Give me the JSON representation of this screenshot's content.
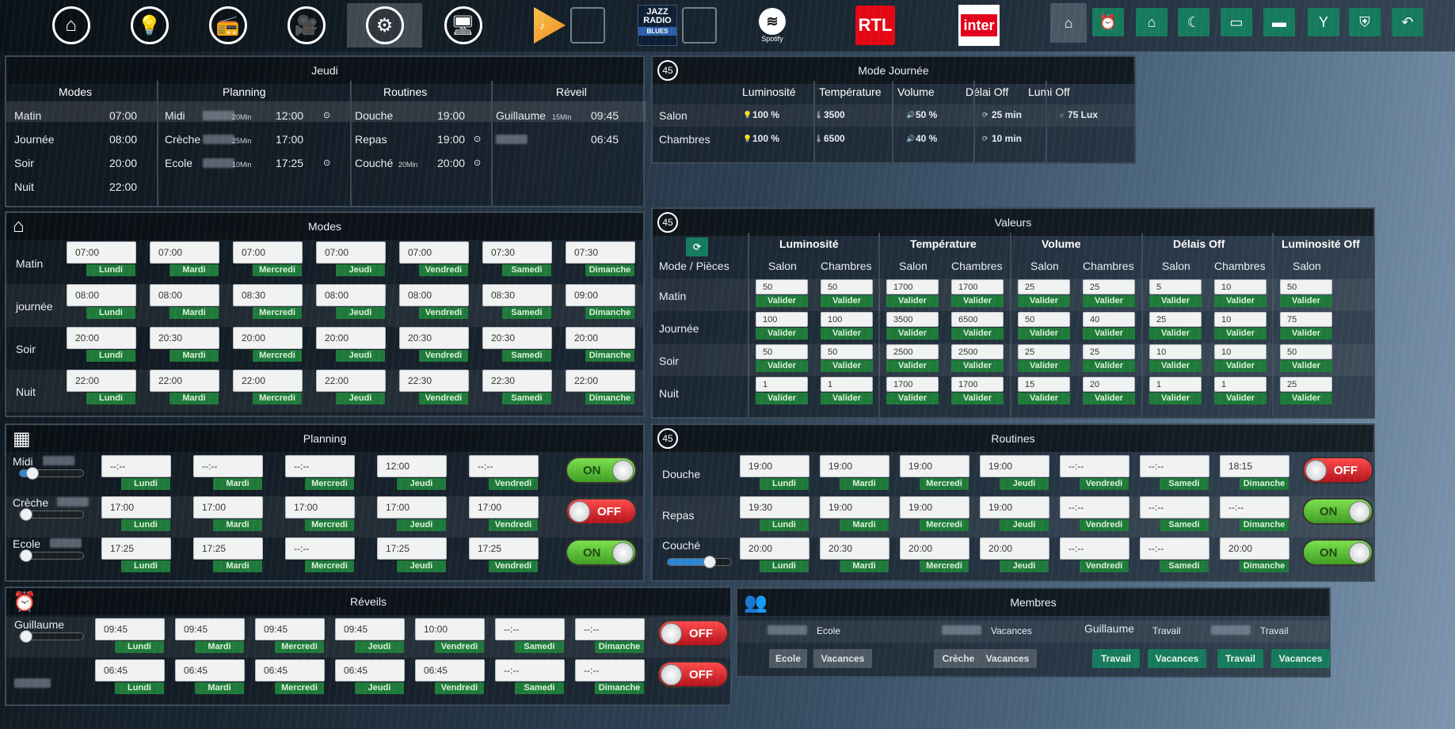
{
  "nav": {
    "items": [
      "home-icon",
      "bulb-icon",
      "radio-icon",
      "camera-icon",
      "gear-icon",
      "monitor-icon"
    ],
    "active": 4
  },
  "media": {
    "jazz": [
      "JAZZ",
      "RADIO"
    ],
    "jazz_sub": "BLUES",
    "spotify": "Spotify",
    "rtl": "RTL",
    "inter": "inter"
  },
  "quick": [
    "home-icon",
    "alarm-icon",
    "house-icon",
    "moon-icon",
    "tv-icon",
    "sofa-icon",
    "cocktail-icon",
    "shield-icon",
    "back-icon"
  ],
  "jeudi": {
    "title": "Jeudi",
    "headers": [
      "Modes",
      "Planning",
      "Routines",
      "Réveil"
    ],
    "modes": [
      [
        "Matin",
        "07:00"
      ],
      [
        "Journée",
        "08:00"
      ],
      [
        "Soir",
        "20:00"
      ],
      [
        "Nuit",
        "22:00"
      ]
    ],
    "planning": [
      [
        "Midi",
        "20Min",
        "12:00"
      ],
      [
        "Crèche",
        "25Min",
        "17:00"
      ],
      [
        "Ecole",
        "10Min",
        "17:25"
      ]
    ],
    "routines": [
      [
        "Douche",
        "",
        "19:00"
      ],
      [
        "Repas",
        "",
        "19:00"
      ],
      [
        "Couché",
        "20Min",
        "20:00"
      ]
    ],
    "reveil": [
      [
        "Guillaume",
        "15Min",
        "09:45"
      ],
      [
        "",
        "",
        "06:45"
      ]
    ]
  },
  "modejournee": {
    "title": "Mode Journée",
    "headers": [
      "Luminosité",
      "Température",
      "Volume",
      "Délai Off",
      "Lumi Off"
    ],
    "rows": [
      {
        "name": "Salon",
        "lum": "100 %",
        "temp": "3500",
        "vol": "50 %",
        "delai": "25 min",
        "lumi": "75 Lux"
      },
      {
        "name": "Chambres",
        "lum": "100 %",
        "temp": "6500",
        "vol": "40 %",
        "delai": "10 min",
        "lumi": ""
      }
    ]
  },
  "modes": {
    "title": "Modes",
    "days": [
      "Lundi",
      "Mardi",
      "Mercredi",
      "Jeudi",
      "Vendredi",
      "Samedi",
      "Dimanche"
    ],
    "rows": [
      {
        "label": "Matin",
        "times": [
          "07:00",
          "07:00",
          "07:00",
          "07:00",
          "07:00",
          "07:30",
          "07:30"
        ]
      },
      {
        "label": "journée",
        "times": [
          "08:00",
          "08:00",
          "08:30",
          "08:00",
          "08:00",
          "08:30",
          "09:00"
        ]
      },
      {
        "label": "Soir",
        "times": [
          "20:00",
          "20:30",
          "20:00",
          "20:00",
          "20:30",
          "20:30",
          "20:00"
        ]
      },
      {
        "label": "Nuit",
        "times": [
          "22:00",
          "22:00",
          "22:00",
          "22:00",
          "22:30",
          "22:30",
          "22:00"
        ]
      }
    ]
  },
  "valeurs": {
    "title": "Valeurs",
    "groups": [
      "Luminosité",
      "Température",
      "Volume",
      "Délais Off",
      "Luminosité Off"
    ],
    "sub": [
      "Salon",
      "Chambres"
    ],
    "rowhead": "Mode / Pièces",
    "validate": "Valider",
    "rows": [
      {
        "label": "Matin",
        "v": [
          "50",
          "50",
          "1700",
          "1700",
          "25",
          "25",
          "5",
          "10",
          "50"
        ]
      },
      {
        "label": "Journée",
        "v": [
          "100",
          "100",
          "3500",
          "6500",
          "50",
          "40",
          "25",
          "10",
          "75"
        ]
      },
      {
        "label": "Soir",
        "v": [
          "50",
          "50",
          "2500",
          "2500",
          "25",
          "25",
          "10",
          "10",
          "50"
        ]
      },
      {
        "label": "Nuit",
        "v": [
          "1",
          "1",
          "1700",
          "1700",
          "15",
          "20",
          "1",
          "1",
          "25"
        ]
      }
    ]
  },
  "planning": {
    "title": "Planning",
    "days": [
      "Lundi",
      "Mardi",
      "Mercredi",
      "Jeudi",
      "Vendredi"
    ],
    "rows": [
      {
        "label": "Midi",
        "times": [
          "--:--",
          "--:--",
          "--:--",
          "12:00",
          "--:--"
        ],
        "state": "ON",
        "level": 0.2
      },
      {
        "label": "Crèche",
        "times": [
          "17:00",
          "17:00",
          "17:00",
          "17:00",
          "17:00"
        ],
        "state": "OFF",
        "level": 0
      },
      {
        "label": "Ecole",
        "times": [
          "17:25",
          "17:25",
          "--:--",
          "17:25",
          "17:25"
        ],
        "state": "ON",
        "level": 0
      }
    ]
  },
  "routines": {
    "title": "Routines",
    "days": [
      "Lundi",
      "Mardi",
      "Mercredi",
      "Jeudi",
      "Vendredi",
      "Samedi",
      "Dimanche"
    ],
    "rows": [
      {
        "label": "Douche",
        "times": [
          "19:00",
          "19:00",
          "19:00",
          "19:00",
          "--:--",
          "--:--",
          "18:15"
        ],
        "state": "OFF"
      },
      {
        "label": "Repas",
        "times": [
          "19:30",
          "19:00",
          "19:00",
          "19:00",
          "--:--",
          "--:--",
          "--:--"
        ],
        "state": "ON"
      },
      {
        "label": "Couché",
        "times": [
          "20:00",
          "20:30",
          "20:00",
          "20:00",
          "--:--",
          "--:--",
          "20:00"
        ],
        "state": "ON",
        "level": 0.65
      }
    ]
  },
  "reveils": {
    "title": "Réveils",
    "days": [
      "Lundi",
      "Mardi",
      "Mercredi",
      "Jeudi",
      "Vendredi",
      "Samedi",
      "Dimanche"
    ],
    "rows": [
      {
        "label": "Guillaume",
        "times": [
          "09:45",
          "09:45",
          "09:45",
          "09:45",
          "10:00",
          "--:--",
          "--:--"
        ],
        "state": "OFF",
        "level": 0
      },
      {
        "label": "",
        "times": [
          "06:45",
          "06:45",
          "06:45",
          "06:45",
          "06:45",
          "--:--",
          "--:--"
        ],
        "state": "OFF"
      }
    ]
  },
  "membres": {
    "title": "Membres",
    "members": [
      {
        "name": "",
        "status": "Ecole",
        "buttons": [
          "Ecole",
          "Vacances"
        ],
        "green": false
      },
      {
        "name": "",
        "status": "Vacances",
        "buttons": [
          "Crèche",
          "Vacances"
        ],
        "green": false
      },
      {
        "name": "Guillaume",
        "status": "Travail",
        "buttons": [
          "Travail",
          "Vacances"
        ],
        "green": true
      },
      {
        "name": "",
        "status": "Travail",
        "buttons": [
          "Travail",
          "Vacances"
        ],
        "green": true
      }
    ]
  }
}
